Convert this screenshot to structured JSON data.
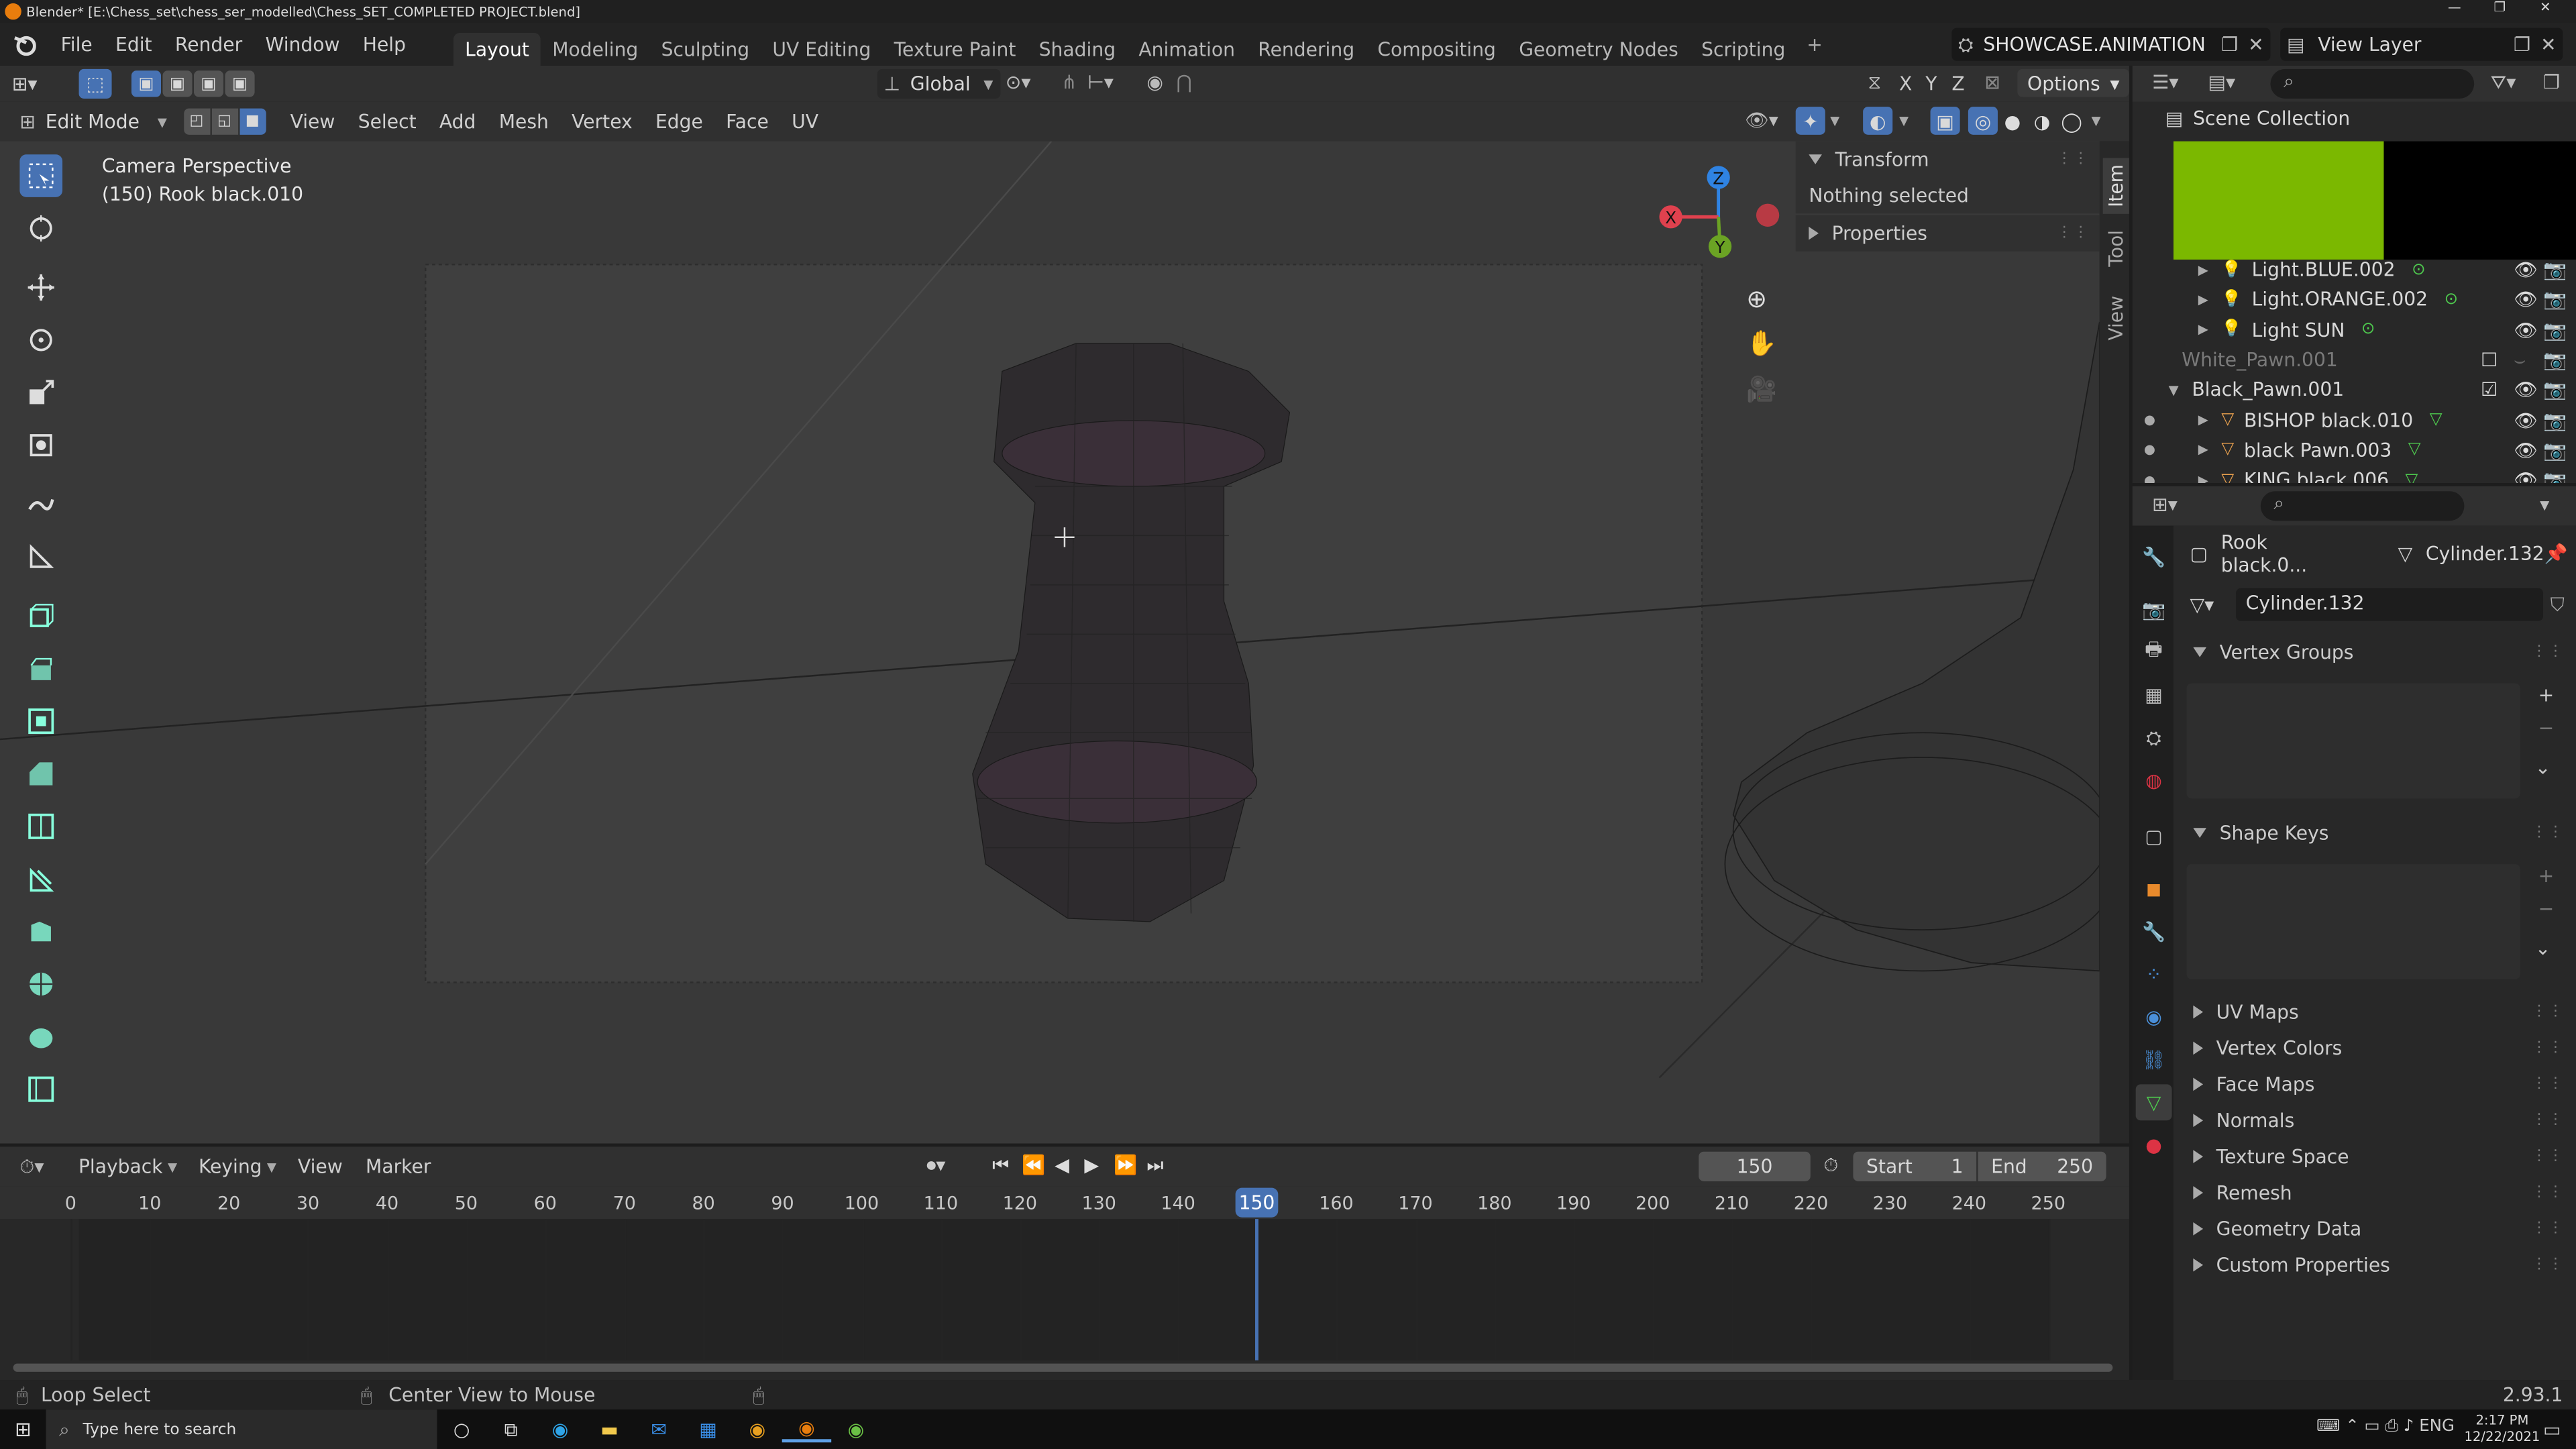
{
  "window": {
    "title": "Blender* [E:\\Chess_set\\chess_ser_modelled\\Chess_SET_COMPLETED PROJECT.blend]"
  },
  "menus": [
    "File",
    "Edit",
    "Render",
    "Window",
    "Help"
  ],
  "workspaces": [
    "Layout",
    "Modeling",
    "Sculpting",
    "UV Editing",
    "Texture Paint",
    "Shading",
    "Animation",
    "Rendering",
    "Compositing",
    "Geometry Nodes",
    "Scripting"
  ],
  "active_workspace": "Layout",
  "scene": "SHOWCASE.ANIMATION",
  "view_layer": "View Layer",
  "viewport": {
    "mode": "Edit Mode",
    "menus": [
      "View",
      "Select",
      "Add",
      "Mesh",
      "Vertex",
      "Edge",
      "Face",
      "UV"
    ],
    "orientation": "Global",
    "options": "Options",
    "overlay_title": "Camera Perspective",
    "overlay_object": "(150) Rook black.010",
    "gizmo_axes": [
      "X",
      "Y",
      "Z"
    ]
  },
  "n_panel": {
    "tabs": [
      "Item",
      "Tool",
      "View"
    ],
    "transform_label": "Transform",
    "nothing_selected": "Nothing selected",
    "properties_label": "Properties"
  },
  "outliner": {
    "title": "Scene Collection",
    "items": [
      {
        "name": "Light.BLUE.002",
        "type": "light",
        "disabled": false
      },
      {
        "name": "Light.ORANGE.002",
        "type": "light",
        "disabled": false
      },
      {
        "name": "Light SUN",
        "type": "light",
        "disabled": false
      },
      {
        "name": "White_Pawn.001",
        "type": "collection",
        "disabled": true
      },
      {
        "name": "Black_Pawn.001",
        "type": "collection",
        "disabled": false
      },
      {
        "name": "BISHOP black.010",
        "type": "mesh",
        "disabled": false
      },
      {
        "name": "black Pawn.003",
        "type": "mesh",
        "disabled": false
      },
      {
        "name": "KING black.006",
        "type": "mesh",
        "disabled": false
      }
    ]
  },
  "properties": {
    "object_name": "Rook black.0...",
    "data_name": "Cylinder.132",
    "mesh_field": "Cylinder.132",
    "sections_open": [
      "Vertex Groups",
      "Shape Keys"
    ],
    "sections_closed": [
      "UV Maps",
      "Vertex Colors",
      "Face Maps",
      "Normals",
      "Texture Space",
      "Remesh",
      "Geometry Data",
      "Custom Properties"
    ]
  },
  "timeline": {
    "menus": [
      "Playback",
      "Keying",
      "View",
      "Marker"
    ],
    "current_frame": "150",
    "start_label": "Start",
    "start": "1",
    "end_label": "End",
    "end": "250",
    "ticks": [
      "0",
      "10",
      "20",
      "30",
      "40",
      "50",
      "60",
      "70",
      "80",
      "90",
      "100",
      "110",
      "120",
      "130",
      "140",
      "150",
      "160",
      "170",
      "180",
      "190",
      "200",
      "210",
      "220",
      "230",
      "240",
      "250"
    ]
  },
  "statusbar": {
    "left": "Loop Select",
    "middle": "Center View to Mouse",
    "version": "2.93.1"
  },
  "taskbar": {
    "search_placeholder": "Type here to search",
    "time": "2:17 PM",
    "date": "12/22/2021"
  },
  "colors": {
    "accent": "#4772b3",
    "viewport_bg": "#3d3d3d",
    "green": "#7bb800",
    "x_axis": "#e0414e",
    "y_axis": "#6ba324",
    "z_axis": "#2f83e3"
  }
}
